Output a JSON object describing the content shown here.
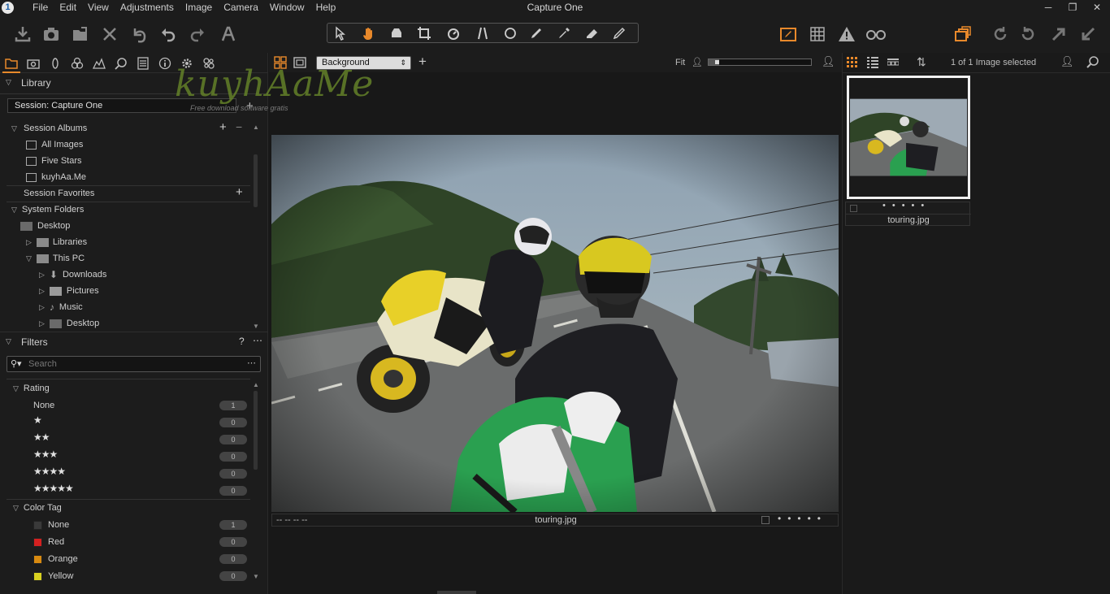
{
  "app": {
    "title": "Capture One"
  },
  "menu": [
    "File",
    "Edit",
    "View",
    "Adjustments",
    "Image",
    "Camera",
    "Window",
    "Help"
  ],
  "library": {
    "title": "Library",
    "session": "Session: Capture One",
    "session_albums": {
      "title": "Session Albums",
      "items": [
        "All Images",
        "Five Stars",
        "kuyhAa.Me"
      ]
    },
    "session_favorites": "Session Favorites",
    "system_folders": {
      "title": "System Folders",
      "desktop": "Desktop",
      "libraries": "Libraries",
      "this_pc": "This PC",
      "children": [
        "Downloads",
        "Pictures",
        "Music",
        "Desktop"
      ]
    }
  },
  "filters": {
    "title": "Filters",
    "help": "?",
    "search_placeholder": "Search",
    "rating": {
      "title": "Rating",
      "rows": [
        {
          "label": "None",
          "stars": "",
          "count": "1"
        },
        {
          "label": "",
          "stars": "★",
          "count": "0"
        },
        {
          "label": "",
          "stars": "★★",
          "count": "0"
        },
        {
          "label": "",
          "stars": "★★★",
          "count": "0"
        },
        {
          "label": "",
          "stars": "★★★★",
          "count": "0"
        },
        {
          "label": "",
          "stars": "★★★★★",
          "count": "0"
        }
      ]
    },
    "color_tag": {
      "title": "Color Tag",
      "rows": [
        {
          "label": "None",
          "color": "#3a3a3a",
          "count": "1"
        },
        {
          "label": "Red",
          "color": "#d42020",
          "count": "0"
        },
        {
          "label": "Orange",
          "color": "#d88a10",
          "count": "0"
        },
        {
          "label": "Yellow",
          "color": "#d8d020",
          "count": "0"
        }
      ]
    }
  },
  "viewer": {
    "background": "Background",
    "fit_label": "Fit",
    "zoom_fraction": 0.1,
    "caption_left": "-- -- -- --",
    "filename": "touring.jpg"
  },
  "browser": {
    "selection": "1 of 1 Image selected",
    "thumb_filename": "touring.jpg"
  },
  "watermark": {
    "text": "kuyhAaMe",
    "sub": "Free download software gratis"
  },
  "colors": {
    "accent": "#e8892b",
    "panel": "#1c1c1c",
    "border": "#555555"
  }
}
